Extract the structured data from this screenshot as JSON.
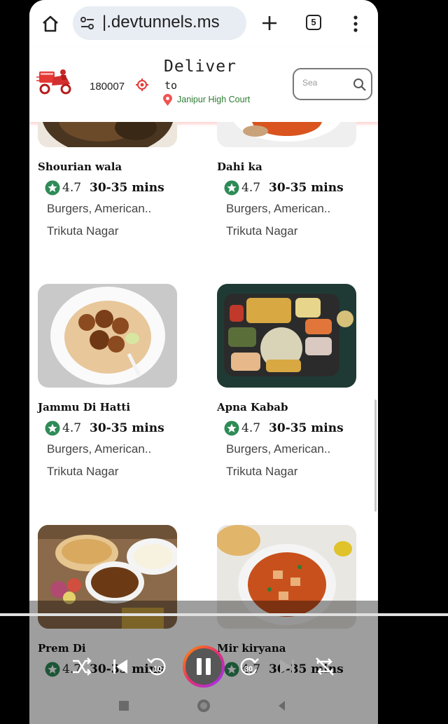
{
  "browser": {
    "url": "|.devtunnels.ms",
    "tab_count": "5"
  },
  "header": {
    "pincode": "180007",
    "deliver_title": "Deliver",
    "deliver_to": "to",
    "location": "Janipur High Court",
    "search_placeholder": "Sea"
  },
  "restaurants": [
    {
      "name": "Shourian wala",
      "rating": "4.7",
      "eta": "30-35 mins",
      "cuisine": "Burgers, American..",
      "area": "Trikuta Nagar"
    },
    {
      "name": "Dahi ka",
      "rating": "4.7",
      "eta": "30-35 mins",
      "cuisine": "Burgers, American..",
      "area": "Trikuta Nagar"
    },
    {
      "name": "Jammu Di Hatti",
      "rating": "4.7",
      "eta": "30-35 mins",
      "cuisine": "Burgers, American..",
      "area": "Trikuta Nagar"
    },
    {
      "name": "Apna Kabab",
      "rating": "4.7",
      "eta": "30-35 mins",
      "cuisine": "Burgers, American..",
      "area": "Trikuta Nagar"
    },
    {
      "name": "Prem Di",
      "rating": "4.7",
      "eta": "30-35 mins",
      "cuisine": "",
      "area": ""
    },
    {
      "name": "Mir kiryana",
      "rating": "4.7",
      "eta": "30-35 mins",
      "cuisine": "",
      "area": ""
    }
  ],
  "player": {
    "progress": 1.0,
    "rewind_seconds": "10",
    "forward_seconds": "30"
  },
  "colors": {
    "brand_red": "#e53935",
    "location_green": "#2e7d32",
    "rating_green": "#2e8b57",
    "url_pill": "#e8ecf3"
  }
}
